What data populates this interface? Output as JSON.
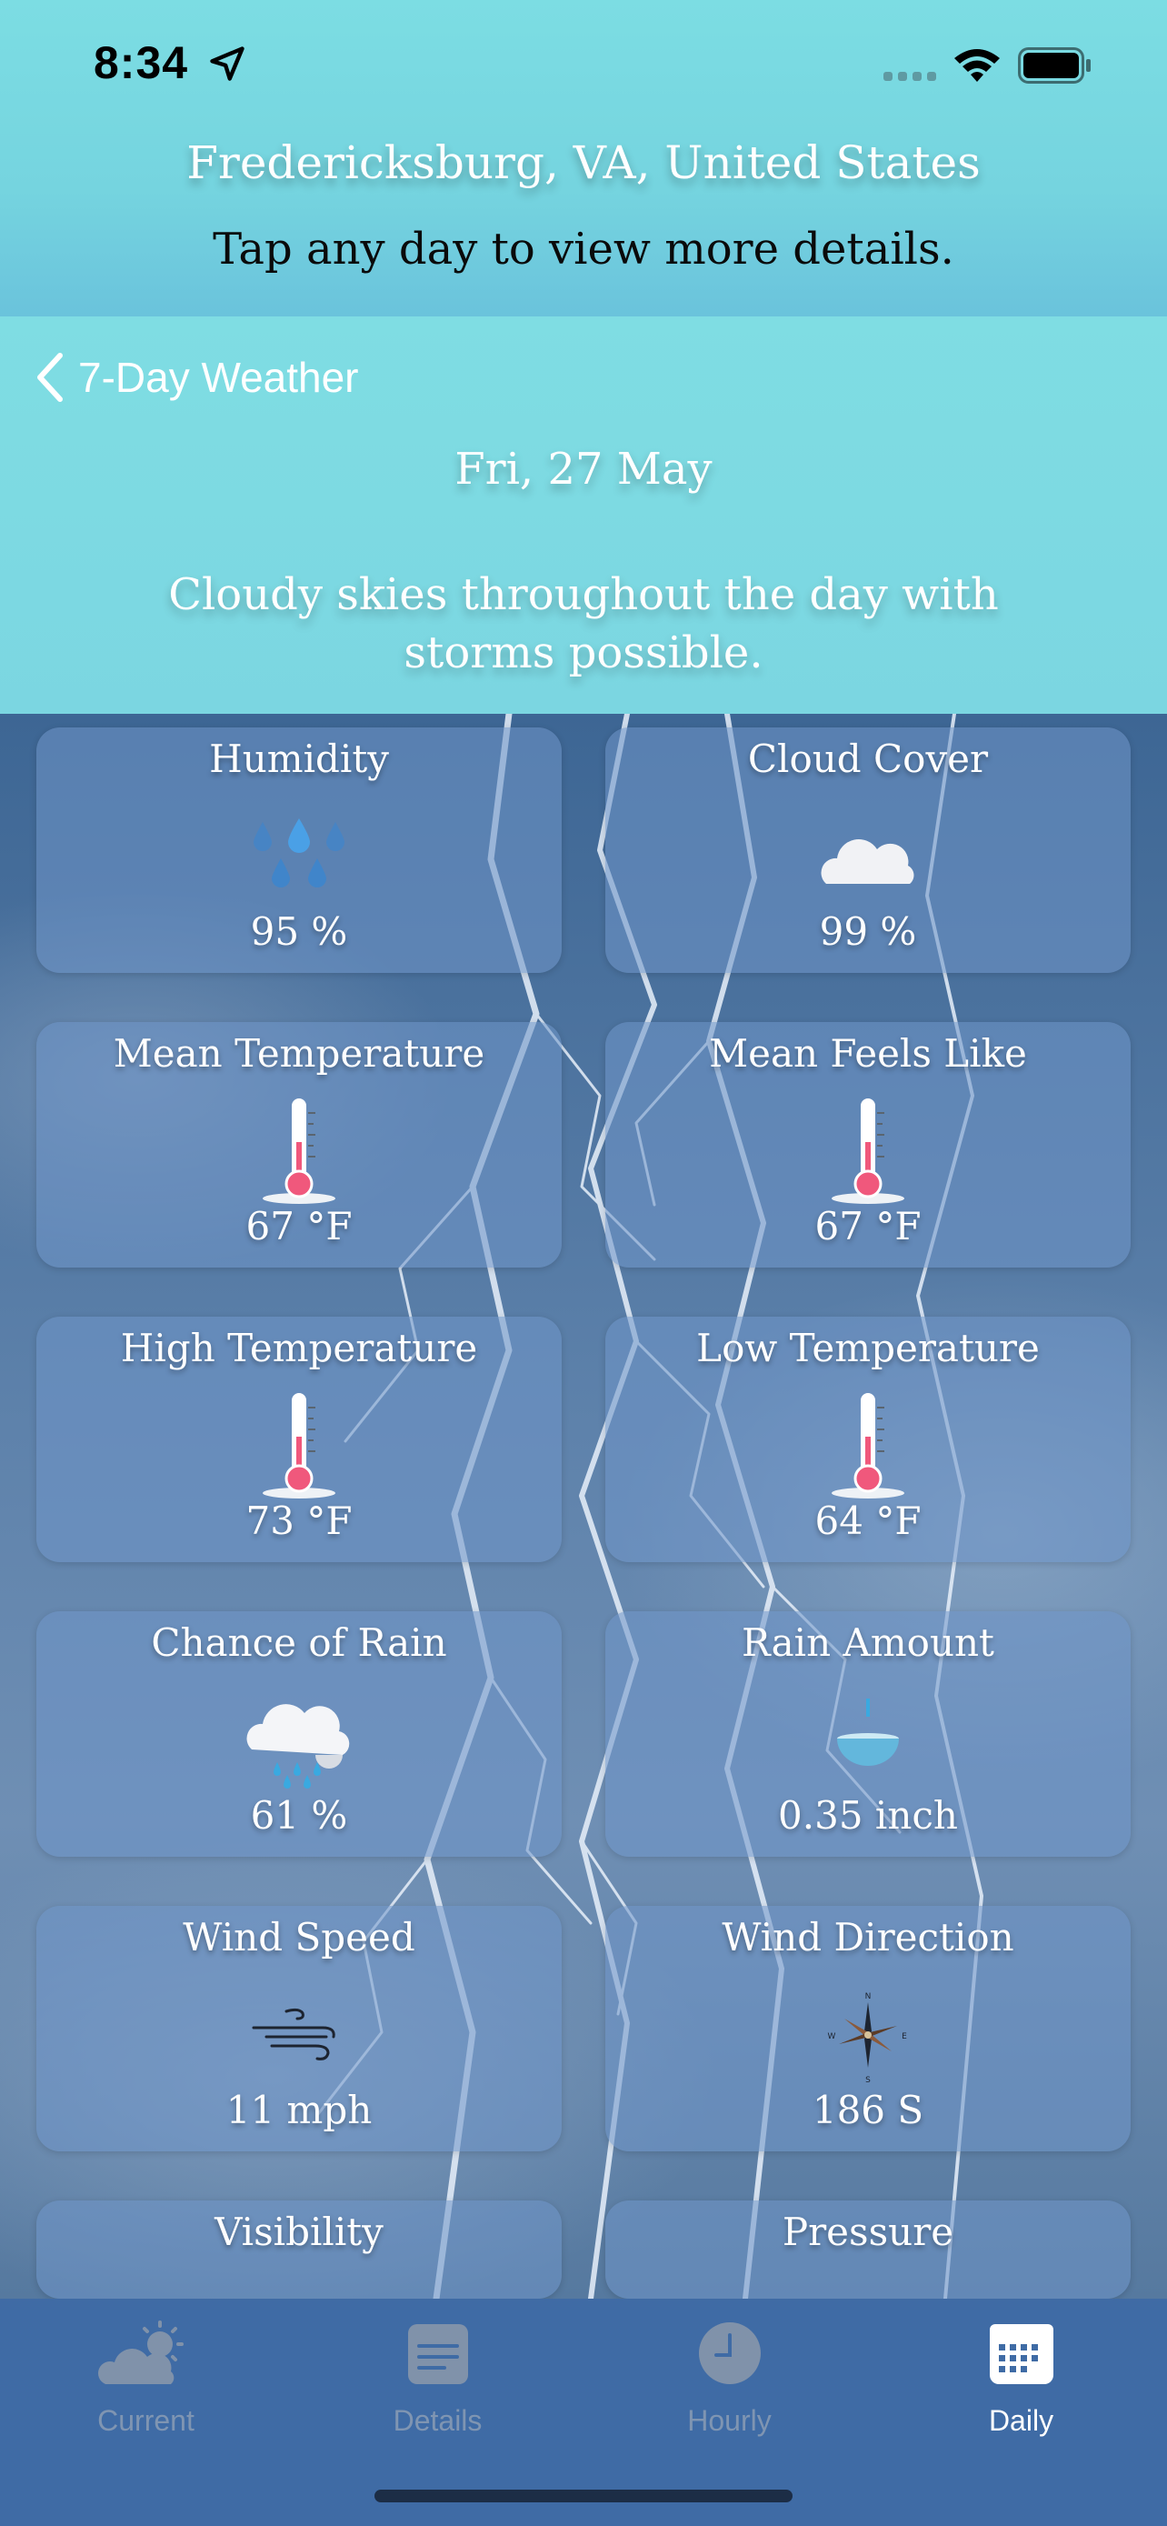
{
  "status_bar": {
    "time": "8:34",
    "icons": [
      "location-arrow-icon",
      "cellular-dots-icon",
      "wifi-icon",
      "battery-icon"
    ]
  },
  "header": {
    "location": "Fredericksburg, VA, United States",
    "hint": "Tap any day to view more details."
  },
  "nav": {
    "back_label": "7-Day Weather",
    "back_icon": "chevron-left-icon"
  },
  "day": {
    "date": "Fri, 27 May",
    "summary": "Cloudy skies throughout the day with storms possible."
  },
  "cards": [
    {
      "title": "Humidity",
      "value": "95 %",
      "icon": "humidity-drops-icon"
    },
    {
      "title": "Cloud Cover",
      "value": "99 %",
      "icon": "cloud-icon"
    },
    {
      "title": "Mean Temperature",
      "value": "67 °F",
      "icon": "thermometer-icon"
    },
    {
      "title": "Mean Feels Like",
      "value": "67 °F",
      "icon": "thermometer-icon"
    },
    {
      "title": "High Temperature",
      "value": "73 °F",
      "icon": "thermometer-icon"
    },
    {
      "title": "Low Temperature",
      "value": "64 °F",
      "icon": "thermometer-icon"
    },
    {
      "title": "Chance of Rain",
      "value": "61 %",
      "icon": "rain-cloud-icon"
    },
    {
      "title": "Rain Amount",
      "value": "0.35 inch",
      "icon": "rain-gauge-icon"
    },
    {
      "title": "Wind Speed",
      "value": "11 mph",
      "icon": "wind-icon"
    },
    {
      "title": "Wind Direction",
      "value": "186 S",
      "icon": "compass-icon"
    },
    {
      "title": "Visibility",
      "value": "",
      "icon": ""
    },
    {
      "title": "Pressure",
      "value": "",
      "icon": ""
    }
  ],
  "tabs": [
    {
      "label": "Current",
      "icon": "partly-cloudy-icon",
      "active": false
    },
    {
      "label": "Details",
      "icon": "details-list-icon",
      "active": false
    },
    {
      "label": "Hourly",
      "icon": "clock-icon",
      "active": false
    },
    {
      "label": "Daily",
      "icon": "calendar-icon",
      "active": true
    }
  ],
  "colors": {
    "header_bg": "#77d6e0",
    "tab_bar_bg": "#3f6ba5",
    "tab_inactive": "#7f95b2",
    "tab_active": "#ffffff",
    "thermometer_bulb": "#f0587c",
    "rain_drop": "#3aa9e0"
  }
}
